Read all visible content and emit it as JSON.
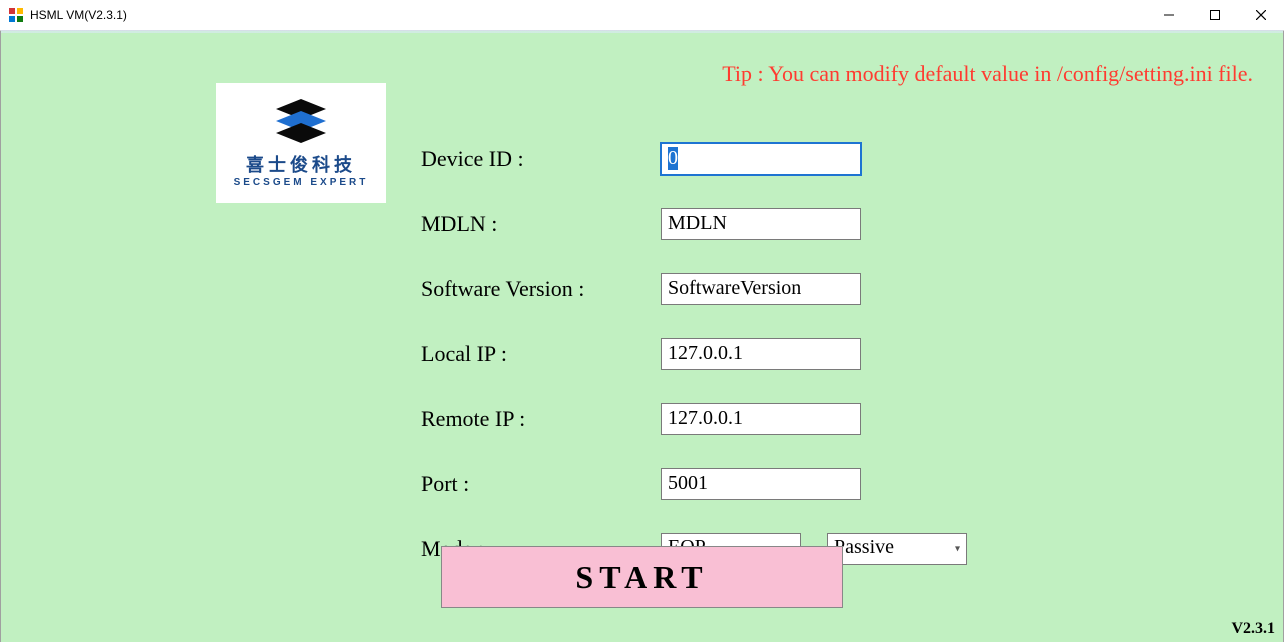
{
  "window": {
    "title": "HSML VM(V2.3.1)"
  },
  "tip": "Tip : You can modify default value in /config/setting.ini file.",
  "logo": {
    "cn": "喜士俊科技",
    "en": "SECSGEM EXPERT"
  },
  "form": {
    "device_id": {
      "label": "Device ID :",
      "value": "0"
    },
    "mdln": {
      "label": "MDLN :",
      "value": "MDLN"
    },
    "software_version": {
      "label": "Software Version :",
      "value": "SoftwareVersion"
    },
    "local_ip": {
      "label": "Local IP :",
      "value": "127.0.0.1"
    },
    "remote_ip": {
      "label": "Remote IP :",
      "value": "127.0.0.1"
    },
    "port": {
      "label": "Port :",
      "value": "5001"
    },
    "mode": {
      "label": "Mode :",
      "value1": "EQP",
      "value2": "Passive"
    }
  },
  "buttons": {
    "start": "START"
  },
  "version": "V2.3.1"
}
